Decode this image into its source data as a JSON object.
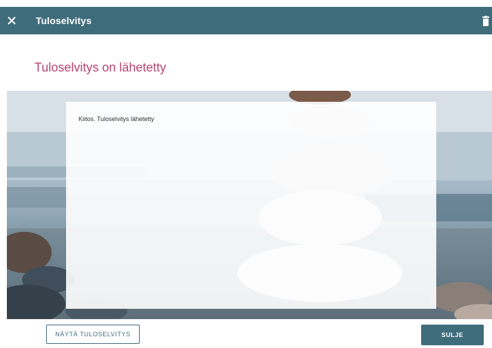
{
  "header": {
    "title": "Tuloselvitys",
    "close_icon": "close-icon",
    "delete_icon": "trash-icon"
  },
  "page": {
    "subtitle": "Tuloselvitys on lähetetty"
  },
  "panel": {
    "message": "Kiitos. Tuloselvitys lähetetty"
  },
  "footer": {
    "show_button_label": "NÄYTÄ TULOSELVITYS",
    "close_button_label": "SULJE"
  },
  "colors": {
    "header_bg": "#3f6c7b",
    "subtitle": "#b5456f",
    "button_bg": "#3f6c7b"
  }
}
